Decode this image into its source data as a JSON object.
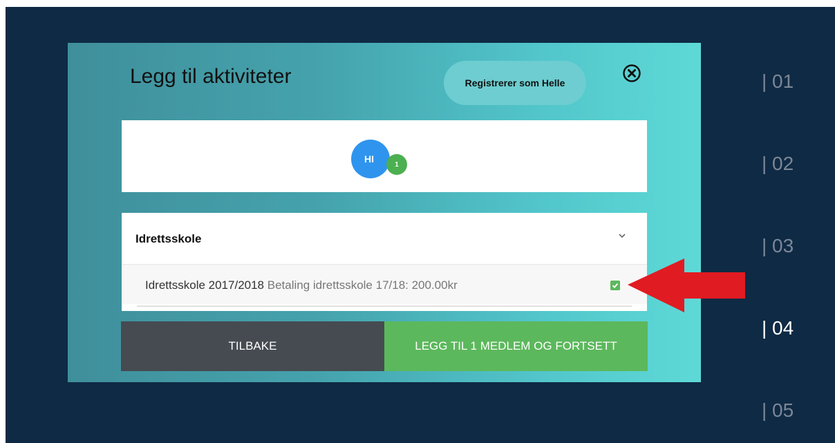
{
  "modal": {
    "title": "Legg til aktiviteter",
    "registering_as": "Registrerer som Helle"
  },
  "members": [
    {
      "initials": "HI",
      "count": "1"
    }
  ],
  "activity_group": {
    "title": "Idrettsskole",
    "activities": [
      {
        "name": "Idrettsskole 2017/2018",
        "price": "Betaling idrettsskole 17/18: 200.00kr",
        "checked": true
      }
    ]
  },
  "buttons": {
    "back": "TILBAKE",
    "continue": "LEGG TIL 1 MEDLEM OG FORTSETT"
  },
  "steps": [
    {
      "label": "| 01",
      "active": false
    },
    {
      "label": "| 02",
      "active": false
    },
    {
      "label": "| 03",
      "active": false
    },
    {
      "label": "| 04",
      "active": true
    },
    {
      "label": "| 05",
      "active": false
    }
  ],
  "colors": {
    "background": "#0f2a44",
    "accent_green": "#5cb85c",
    "avatar_blue": "#2f94ee",
    "annotation_red": "#e11b22"
  },
  "icons": {
    "close": "close-circle-icon",
    "chevron": "chevron-down-icon",
    "checkbox": "checkbox-checked-icon",
    "annotation": "red-arrow-annotation"
  }
}
